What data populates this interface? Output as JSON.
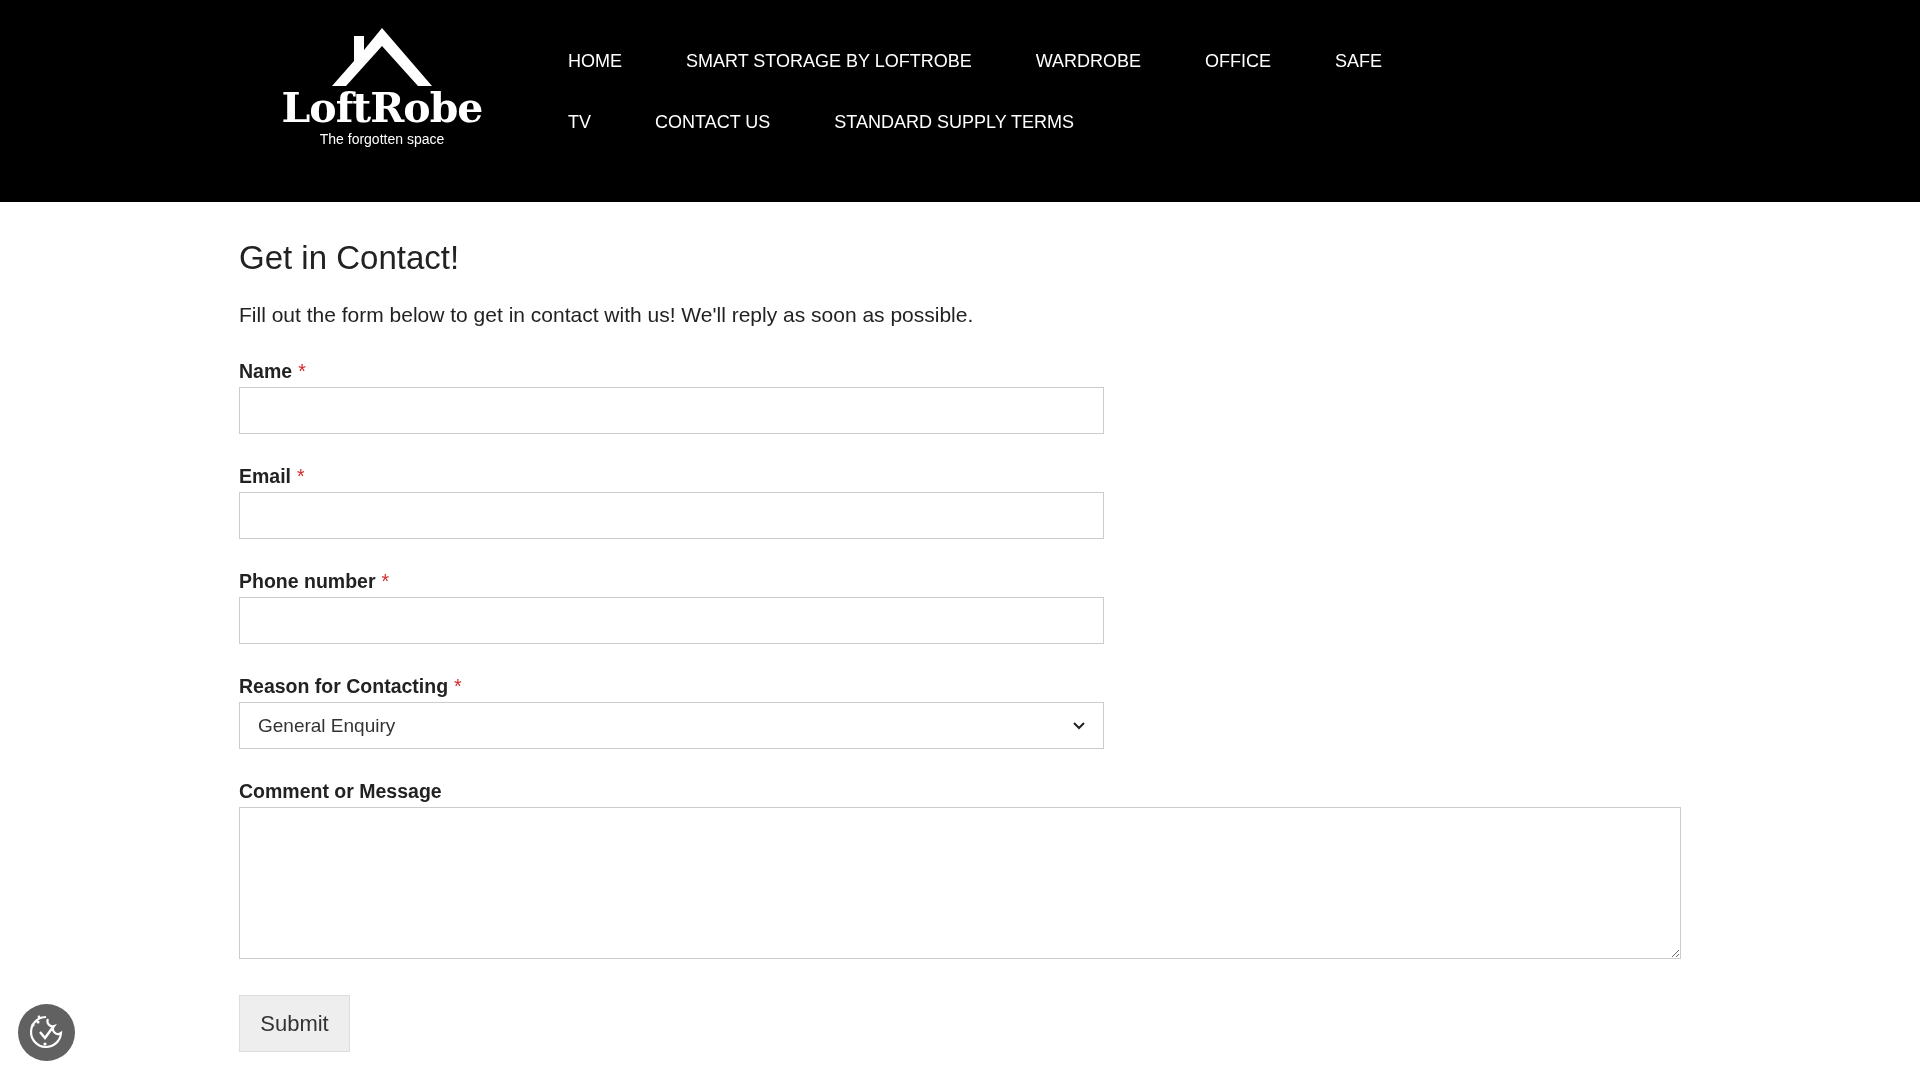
{
  "logo": {
    "name": "LoftRobe",
    "tagline": "The forgotten space"
  },
  "nav": [
    {
      "label": "HOME"
    },
    {
      "label": "SMART STORAGE BY LOFTROBE"
    },
    {
      "label": "WARDROBE"
    },
    {
      "label": "OFFICE"
    },
    {
      "label": "SAFE"
    },
    {
      "label": "TV"
    },
    {
      "label": "CONTACT US"
    },
    {
      "label": "STANDARD SUPPLY TERMS"
    }
  ],
  "heading": "Get in Contact!",
  "intro": "Fill out the form below to get in contact with us! We'll reply as soon as possible.",
  "required_marker": "*",
  "fields": [
    {
      "kind": "text",
      "label": "Name",
      "required": true
    },
    {
      "kind": "text",
      "label": "Email",
      "required": true
    },
    {
      "kind": "text",
      "label": "Phone number",
      "required": true
    },
    {
      "kind": "select",
      "label": "Reason for Contacting",
      "required": true,
      "value": "General Enquiry"
    },
    {
      "kind": "textarea",
      "label": "Comment or Message",
      "required": false
    }
  ],
  "submit": "Submit"
}
